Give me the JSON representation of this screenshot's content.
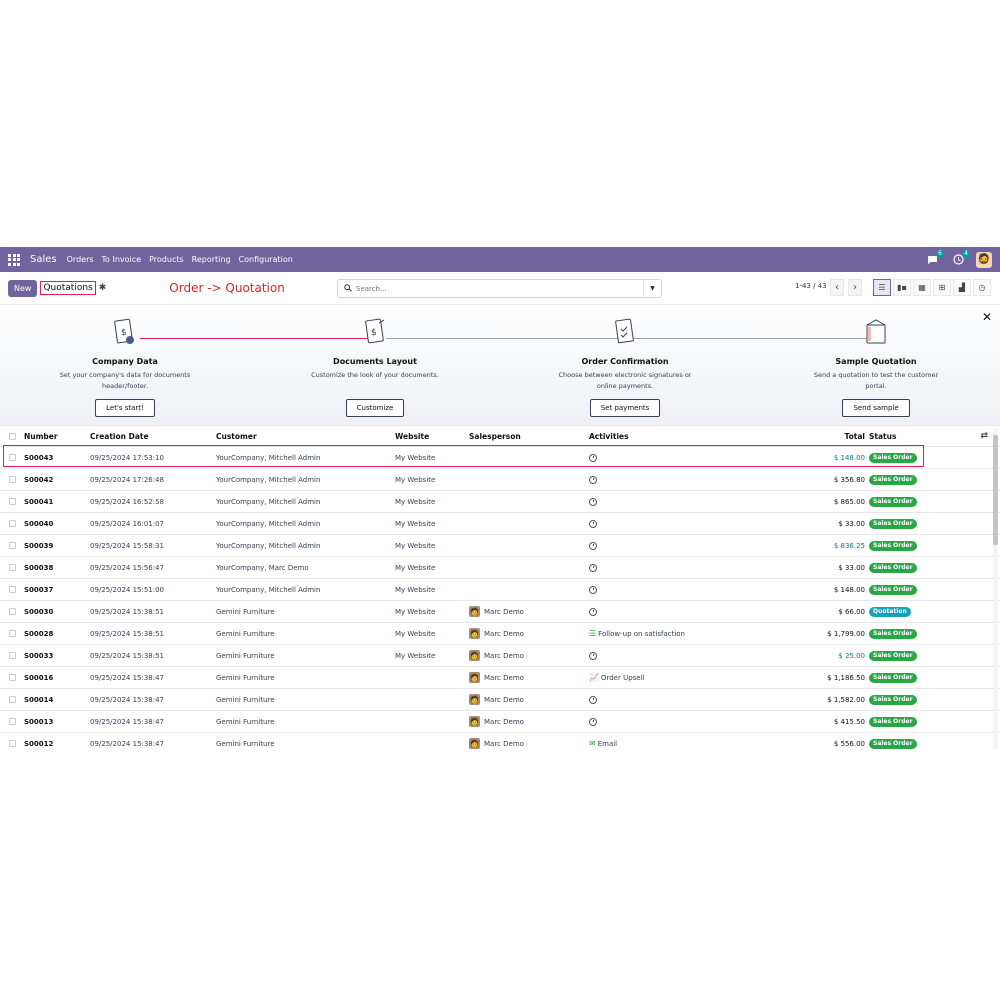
{
  "nav": {
    "brand": "Sales",
    "menu": [
      "Orders",
      "To Invoice",
      "Products",
      "Reporting",
      "Configuration"
    ],
    "chat_count": "6",
    "activity_count": "4"
  },
  "control": {
    "new_label": "New",
    "breadcrumb": "Quotations",
    "annotation": "Order -> Quotation",
    "search_placeholder": "Search...",
    "pager": "1-43 / 43"
  },
  "onboarding": [
    {
      "title": "Company Data",
      "desc": "Set your company's data for documents header/footer.",
      "button": "Let's start!"
    },
    {
      "title": "Documents Layout",
      "desc": "Customize the look of your documents.",
      "button": "Customize"
    },
    {
      "title": "Order Confirmation",
      "desc": "Choose between electronic signatures or online payments.",
      "button": "Set payments"
    },
    {
      "title": "Sample Quotation",
      "desc": "Send a quotation to test the customer portal.",
      "button": "Send sample"
    }
  ],
  "table": {
    "headers": {
      "number": "Number",
      "date": "Creation Date",
      "customer": "Customer",
      "website": "Website",
      "salesperson": "Salesperson",
      "activities": "Activities",
      "total": "Total",
      "status": "Status"
    },
    "rows": [
      {
        "number": "S00043",
        "date": "09/25/2024 17:53:10",
        "customer": "YourCompany, Mitchell Admin",
        "website": "My Website",
        "salesperson": "",
        "activity": "",
        "total": "$ 148.00",
        "status": "Sales Order"
      },
      {
        "number": "S00042",
        "date": "09/25/2024 17:26:48",
        "customer": "YourCompany, Mitchell Admin",
        "website": "My Website",
        "salesperson": "",
        "activity": "",
        "total": "$ 356.80",
        "status": "Sales Order"
      },
      {
        "number": "S00041",
        "date": "09/25/2024 16:52:58",
        "customer": "YourCompany, Mitchell Admin",
        "website": "My Website",
        "salesperson": "",
        "activity": "",
        "total": "$ 865.00",
        "status": "Sales Order"
      },
      {
        "number": "S00040",
        "date": "09/25/2024 16:01:07",
        "customer": "YourCompany, Mitchell Admin",
        "website": "My Website",
        "salesperson": "",
        "activity": "",
        "total": "$ 33.00",
        "status": "Sales Order"
      },
      {
        "number": "S00039",
        "date": "09/25/2024 15:58:31",
        "customer": "YourCompany, Mitchell Admin",
        "website": "My Website",
        "salesperson": "",
        "activity": "",
        "total": "$ 836.25",
        "status": "Sales Order"
      },
      {
        "number": "S00038",
        "date": "09/25/2024 15:56:47",
        "customer": "YourCompany, Marc Demo",
        "website": "My Website",
        "salesperson": "",
        "activity": "",
        "total": "$ 33.00",
        "status": "Sales Order"
      },
      {
        "number": "S00037",
        "date": "09/25/2024 15:51:00",
        "customer": "YourCompany, Mitchell Admin",
        "website": "My Website",
        "salesperson": "",
        "activity": "",
        "total": "$ 148.00",
        "status": "Sales Order"
      },
      {
        "number": "S00030",
        "date": "09/25/2024 15:38:51",
        "customer": "Gemini Furniture",
        "website": "My Website",
        "salesperson": "Marc Demo",
        "activity": "",
        "total": "$ 66.00",
        "status": "Quotation"
      },
      {
        "number": "S00028",
        "date": "09/25/2024 15:38:51",
        "customer": "Gemini Furniture",
        "website": "My Website",
        "salesperson": "Marc Demo",
        "activity": "Follow-up on satisfaction",
        "total": "$ 1,799.00",
        "status": "Sales Order"
      },
      {
        "number": "S00033",
        "date": "09/25/2024 15:38:51",
        "customer": "Gemini Furniture",
        "website": "My Website",
        "salesperson": "Marc Demo",
        "activity": "",
        "total": "$ 25.00",
        "status": "Sales Order"
      },
      {
        "number": "S00016",
        "date": "09/25/2024 15:38:47",
        "customer": "Gemini Furniture",
        "website": "",
        "salesperson": "Marc Demo",
        "activity": "Order Upsell",
        "total": "$ 1,186.50",
        "status": "Sales Order"
      },
      {
        "number": "S00014",
        "date": "09/25/2024 15:38:47",
        "customer": "Gemini Furniture",
        "website": "",
        "salesperson": "Marc Demo",
        "activity": "",
        "total": "$ 1,582.00",
        "status": "Sales Order"
      },
      {
        "number": "S00013",
        "date": "09/25/2024 15:38:47",
        "customer": "Gemini Furniture",
        "website": "",
        "salesperson": "Marc Demo",
        "activity": "",
        "total": "$ 415.50",
        "status": "Sales Order"
      },
      {
        "number": "S00012",
        "date": "09/25/2024 15:38:47",
        "customer": "Gemini Furniture",
        "website": "",
        "salesperson": "Marc Demo",
        "activity": "Email",
        "total": "$ 556.00",
        "status": "Sales Order"
      }
    ]
  },
  "colors": {
    "brand": "#71639e",
    "sales_order": "#28a745",
    "quotation": "#17a2b8",
    "teal_total": "#017e84",
    "highlight": "#e11d48"
  }
}
